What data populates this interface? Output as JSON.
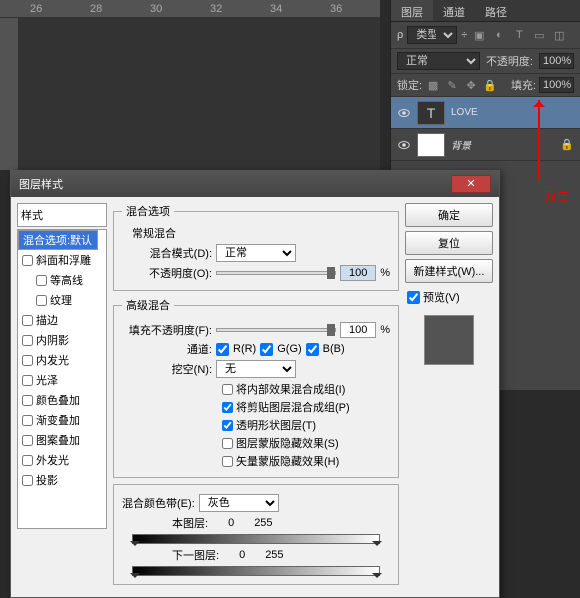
{
  "ruler": {
    "marks": [
      "26",
      "28",
      "30",
      "32",
      "34",
      "36"
    ]
  },
  "panels": {
    "tabs": [
      "图层",
      "通道",
      "路径"
    ],
    "filter_label": "类型",
    "mode": "正常",
    "opacity_label": "不透明度:",
    "opacity_val": "100%",
    "lock_label": "锁定:",
    "fill_label": "填充:",
    "fill_val": "100%",
    "layers": [
      {
        "name": "LOVE",
        "type": "T",
        "selected": true
      },
      {
        "name": "背景",
        "type": "bg",
        "selected": false
      }
    ]
  },
  "annotation": "双击",
  "dialog": {
    "title": "图层样式",
    "styles_header": "样式",
    "styles": [
      {
        "label": "混合选项:默认",
        "sel": true
      },
      {
        "label": "斜面和浮雕",
        "checkbox": true
      },
      {
        "label": "等高线",
        "checkbox": true,
        "indent": true
      },
      {
        "label": "纹理",
        "checkbox": true,
        "indent": true
      },
      {
        "label": "描边",
        "checkbox": true
      },
      {
        "label": "内阴影",
        "checkbox": true
      },
      {
        "label": "内发光",
        "checkbox": true
      },
      {
        "label": "光泽",
        "checkbox": true
      },
      {
        "label": "颜色叠加",
        "checkbox": true
      },
      {
        "label": "渐变叠加",
        "checkbox": true
      },
      {
        "label": "图案叠加",
        "checkbox": true
      },
      {
        "label": "外发光",
        "checkbox": true
      },
      {
        "label": "投影",
        "checkbox": true
      }
    ],
    "blend_opts": {
      "legend": "混合选项",
      "general": "常规混合",
      "mode_label": "混合模式(D):",
      "mode_val": "正常",
      "opacity_label": "不透明度(O):",
      "opacity_val": "100",
      "pct": "%"
    },
    "advanced": {
      "legend": "高级混合",
      "fill_label": "填充不透明度(F):",
      "fill_val": "100",
      "pct": "%",
      "channel_label": "通道:",
      "r": "R(R)",
      "g": "G(G)",
      "b": "B(B)",
      "knockout_label": "挖空(N):",
      "knockout_val": "无",
      "opts": [
        {
          "label": "将内部效果混合成组(I)",
          "checked": false
        },
        {
          "label": "将剪贴图层混合成组(P)",
          "checked": true
        },
        {
          "label": "透明形状图层(T)",
          "checked": true
        },
        {
          "label": "图层蒙版隐藏效果(S)",
          "checked": false
        },
        {
          "label": "矢量蒙版隐藏效果(H)",
          "checked": false
        }
      ]
    },
    "blend_if": {
      "label": "混合颜色带(E):",
      "val": "灰色",
      "this_label": "本图层:",
      "this_lo": "0",
      "this_hi": "255",
      "under_label": "下一图层:",
      "under_lo": "0",
      "under_hi": "255"
    },
    "buttons": {
      "ok": "确定",
      "cancel": "复位",
      "new_style": "新建样式(W)...",
      "preview": "预览(V)"
    }
  }
}
